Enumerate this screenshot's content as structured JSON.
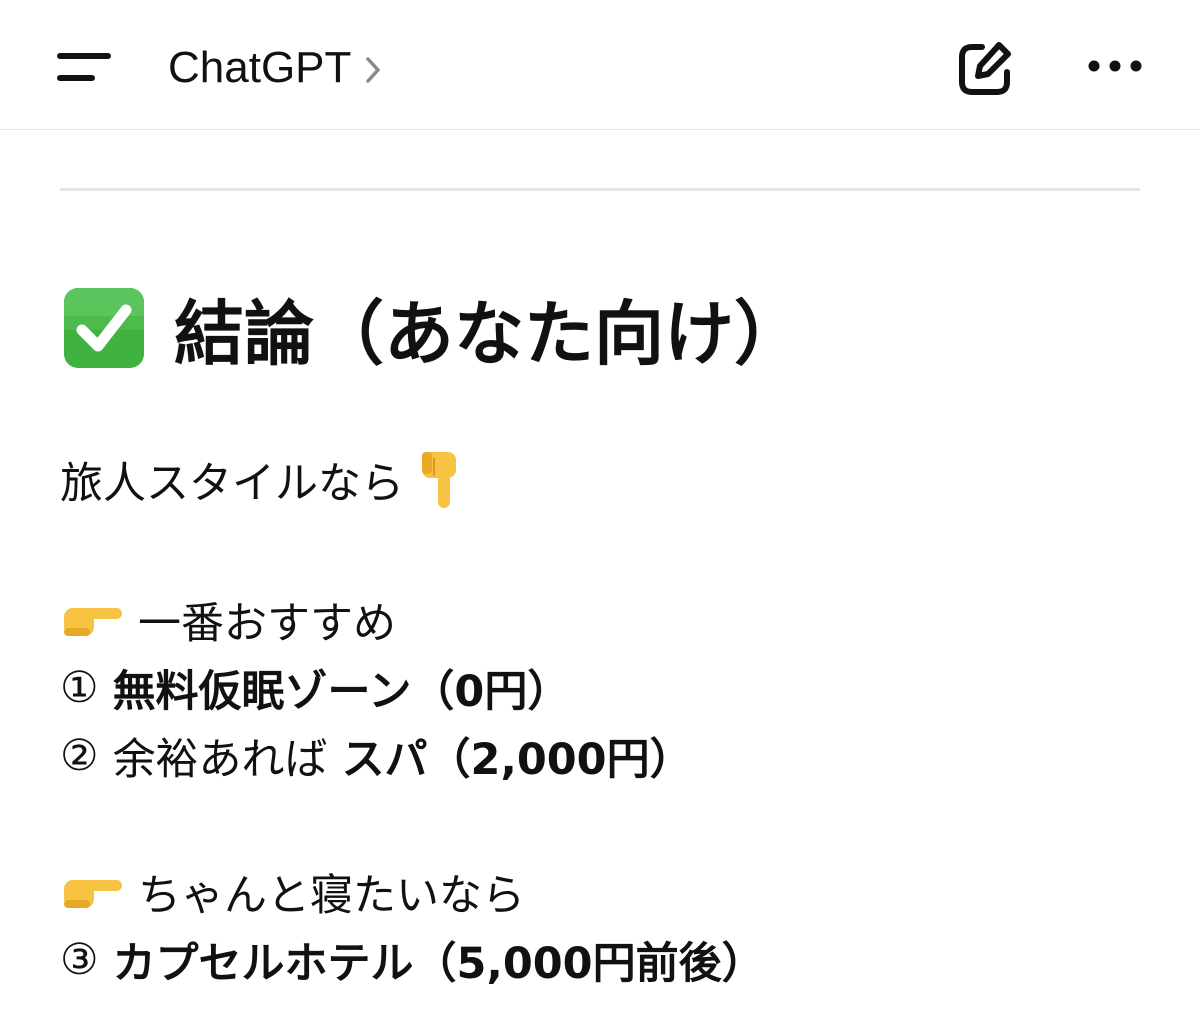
{
  "header": {
    "title": "ChatGPT",
    "menu_icon": "menu-icon",
    "chevron_icon": "chevron-right-icon",
    "new_chat_icon": "edit-icon",
    "more_icon": "more-horizontal-icon"
  },
  "message": {
    "heading": {
      "icon": "check-mark-button-icon",
      "text": "結論（あなた向け）"
    },
    "intro": {
      "text": "旅人スタイルなら",
      "icon": "pointing-down-icon"
    },
    "section1": {
      "icon": "pointing-right-icon",
      "label": "一番おすすめ",
      "item1_num": "①",
      "item1_bold": "無料仮眠ゾーン（0円）",
      "item2_num": "②",
      "item2_pre": "余裕あれば",
      "item2_bold": "スパ（2,000円）"
    },
    "section2": {
      "icon": "pointing-right-icon",
      "label": "ちゃんと寝たいなら",
      "item3_num": "③",
      "item3_bold": "カプセルホテル（5,000円前後）"
    }
  },
  "colors": {
    "text": "#111111",
    "divider": "#e5e5e5",
    "check_green": "#3fb23f",
    "emoji_hand": "#f6c343"
  }
}
